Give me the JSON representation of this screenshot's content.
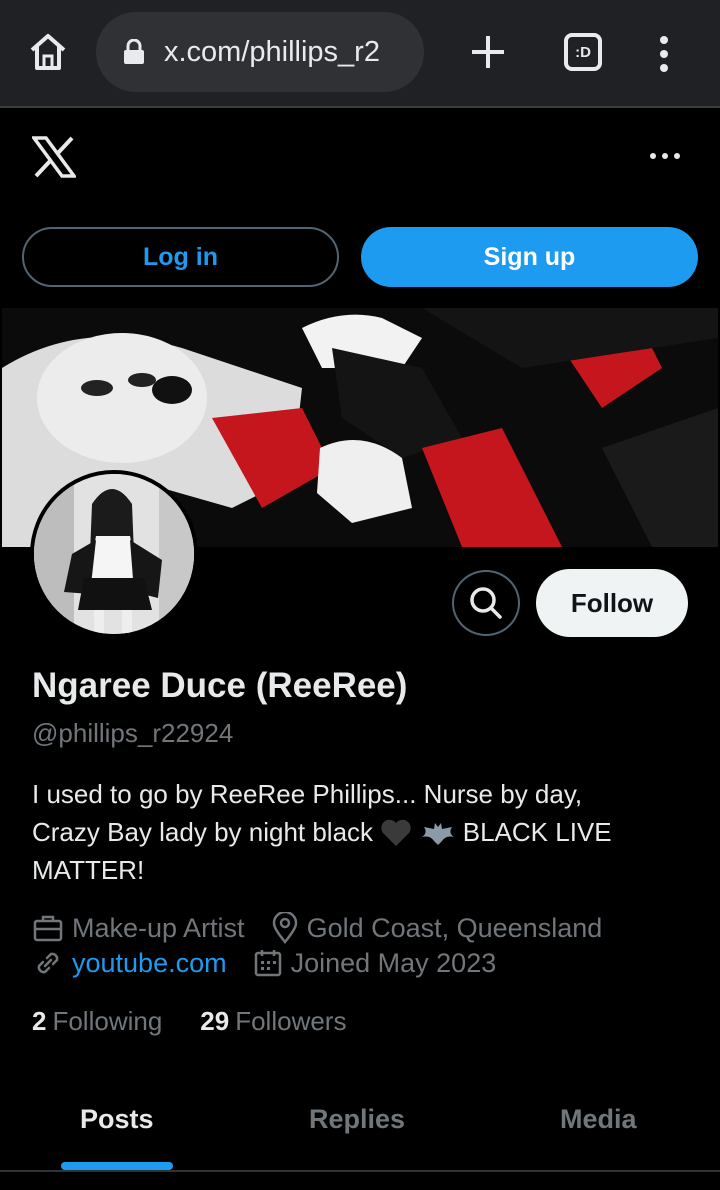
{
  "browser": {
    "url": "x.com/phillips_r2",
    "tabs_label": ":D",
    "icons": [
      "home-icon",
      "lock-icon",
      "plus-icon",
      "tabs-icon",
      "menu-icon"
    ]
  },
  "header": {
    "logo": "x-logo",
    "more_icon": "more-icon"
  },
  "auth": {
    "login_label": "Log in",
    "signup_label": "Sign up"
  },
  "profile": {
    "display_name": "Ngaree Duce (ReeRee)",
    "handle": "@phillips_r22924",
    "bio_line1": "I used to go by ReeRee Phillips... Nurse by day,",
    "bio_line2a": "Crazy Bay lady  by night black",
    "bio_line2b": "BLACK LIVE",
    "bio_line3": "MATTER!",
    "profession": "Make-up Artist",
    "location": "Gold Coast, Queensland",
    "website": "youtube.com",
    "joined": "Joined May 2023",
    "following_count": "2",
    "following_label": "Following",
    "followers_count": "29",
    "followers_label": "Followers",
    "follow_label": "Follow"
  },
  "tabs": [
    {
      "label": "Posts",
      "active": true
    },
    {
      "label": "Replies",
      "active": false
    },
    {
      "label": "Media",
      "active": false
    }
  ],
  "colors": {
    "accent": "#1d9bf0",
    "background": "#000000",
    "muted_text": "#71767b",
    "primary_text": "#e7e9ea"
  }
}
